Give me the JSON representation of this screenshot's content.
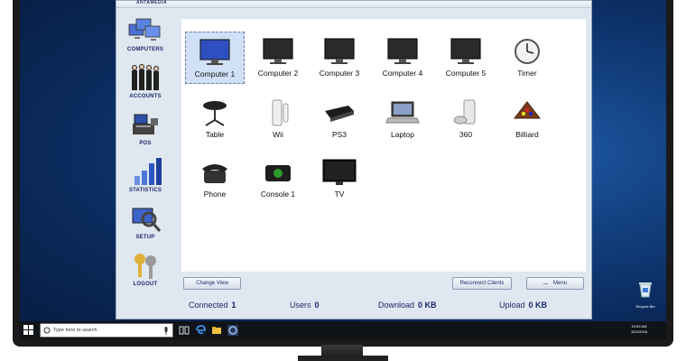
{
  "app": {
    "logo": "ANTAMEDIA",
    "sidebar": [
      {
        "label": "COMPUTERS",
        "icon": "computers-icon"
      },
      {
        "label": "ACCOUNTS",
        "icon": "accounts-icon"
      },
      {
        "label": "POS",
        "icon": "pos-icon"
      },
      {
        "label": "STATISTICS",
        "icon": "statistics-icon"
      },
      {
        "label": "SETUP",
        "icon": "setup-icon"
      },
      {
        "label": "LOGOUT",
        "icon": "logout-icon"
      }
    ],
    "tiles": [
      {
        "label": "Computer 1",
        "icon": "monitor-icon",
        "selected": true
      },
      {
        "label": "Computer 2",
        "icon": "monitor-icon"
      },
      {
        "label": "Computer 3",
        "icon": "monitor-icon"
      },
      {
        "label": "Computer 4",
        "icon": "monitor-icon"
      },
      {
        "label": "Computer 5",
        "icon": "monitor-icon"
      },
      {
        "label": "Timer",
        "icon": "clock-icon"
      },
      {
        "label": "Table",
        "icon": "table-icon"
      },
      {
        "label": "Wii",
        "icon": "wii-icon"
      },
      {
        "label": "PS3",
        "icon": "ps3-icon"
      },
      {
        "label": "Laptop",
        "icon": "laptop-icon"
      },
      {
        "label": "360",
        "icon": "xbox360-icon"
      },
      {
        "label": "Billiard",
        "icon": "billiard-icon"
      },
      {
        "label": "Phone",
        "icon": "phone-icon"
      },
      {
        "label": "Console 1",
        "icon": "console-icon"
      },
      {
        "label": "TV",
        "icon": "tv-icon"
      }
    ],
    "buttons": {
      "change_view": "Change View",
      "reconnect_clients": "Reconnect Clients",
      "menu_dots": "...",
      "menu": "Menu"
    },
    "status": {
      "connected_label": "Connected",
      "connected_value": "1",
      "users_label": "Users",
      "users_value": "0",
      "download_label": "Download",
      "download_value": "0 KB",
      "upload_label": "Upload",
      "upload_value": "0 KB"
    }
  },
  "desktop": {
    "recycle_bin_label": "Recycle Bin"
  },
  "taskbar": {
    "search_placeholder": "Type here to search",
    "time": "10:59 AM",
    "date": "3/22/2018"
  },
  "colors": {
    "accent_text": "#1b2a6b",
    "desktop_blue": "#123f7e",
    "taskbar": "#101418"
  }
}
